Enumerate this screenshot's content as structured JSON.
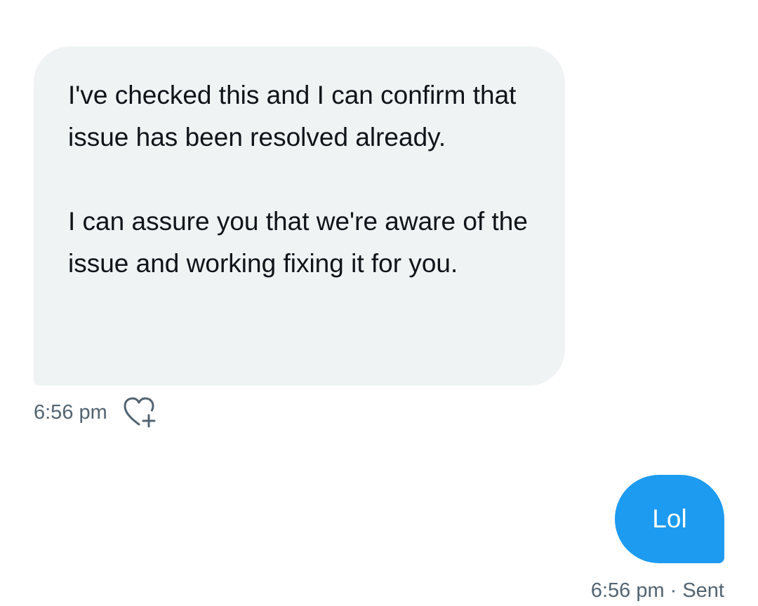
{
  "received_message": {
    "paragraph_1": "I've checked this and I can confirm that issue has been resolved already.",
    "paragraph_2": "I can assure you that we're aware of the issue and working fixing it for you.",
    "time": "6:56 pm",
    "react_icon": "heart-plus-icon"
  },
  "sent_message": {
    "text": "Lol",
    "time": "6:56 pm",
    "separator": "·",
    "status": "Sent"
  },
  "colors": {
    "received_bubble": "#eff3f4",
    "sent_bubble": "#1d9bf0",
    "meta_text": "#536471",
    "body_text": "#0f1419"
  }
}
